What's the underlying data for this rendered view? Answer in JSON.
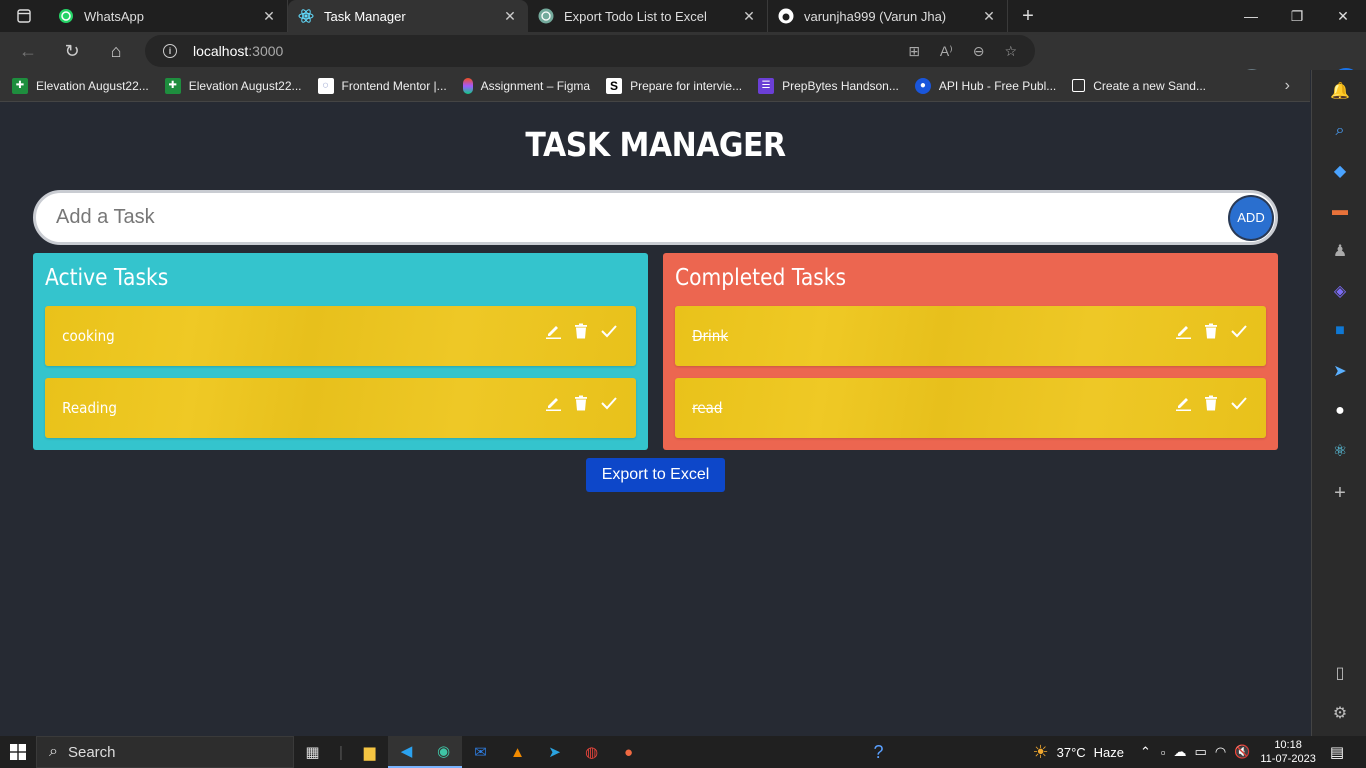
{
  "browser": {
    "tabs": [
      {
        "title": "WhatsApp",
        "icon": "whatsapp-icon",
        "active": false
      },
      {
        "title": "Task Manager",
        "icon": "react-icon",
        "active": true
      },
      {
        "title": "Export Todo List to Excel",
        "icon": "chatgpt-icon",
        "active": false
      },
      {
        "title": "varunjha999 (Varun Jha)",
        "icon": "github-icon",
        "active": false
      }
    ],
    "url_host": "localhost",
    "url_port": ":3000",
    "favorites": [
      {
        "label": "Elevation August22...",
        "color": "#1e8e3e"
      },
      {
        "label": "Elevation August22...",
        "color": "#1e8e3e"
      },
      {
        "label": "Frontend Mentor |...",
        "color": "#ffffff"
      },
      {
        "label": "Assignment – Figma",
        "color": "#f24e1e"
      },
      {
        "label": "Prepare for intervie...",
        "color": "#ffffff"
      },
      {
        "label": "PrepBytes Handson...",
        "color": "#6b3fd6"
      },
      {
        "label": "API Hub - Free Publ...",
        "color": "#1a56db"
      },
      {
        "label": "Create a new Sand...",
        "color": "#ffffff"
      }
    ]
  },
  "app": {
    "title": "TASK MANAGER",
    "input_placeholder": "Add a Task",
    "add_label": "ADD",
    "active_title": "Active Tasks",
    "completed_title": "Completed Tasks",
    "active_tasks": [
      "cooking",
      "Reading"
    ],
    "completed_tasks": [
      "Drink",
      "read"
    ],
    "export_label": "Export to Excel"
  },
  "taskbar": {
    "search_label": "Search",
    "weather_temp": "37°C",
    "weather_desc": "Haze",
    "time": "10:18",
    "date": "11-07-2023"
  },
  "colors": {
    "active_panel": "#34c4cd",
    "completed_panel": "#ec6650",
    "task_card": "#ecc521",
    "export_button": "#0d47c9",
    "add_button": "#2a6fcf"
  }
}
